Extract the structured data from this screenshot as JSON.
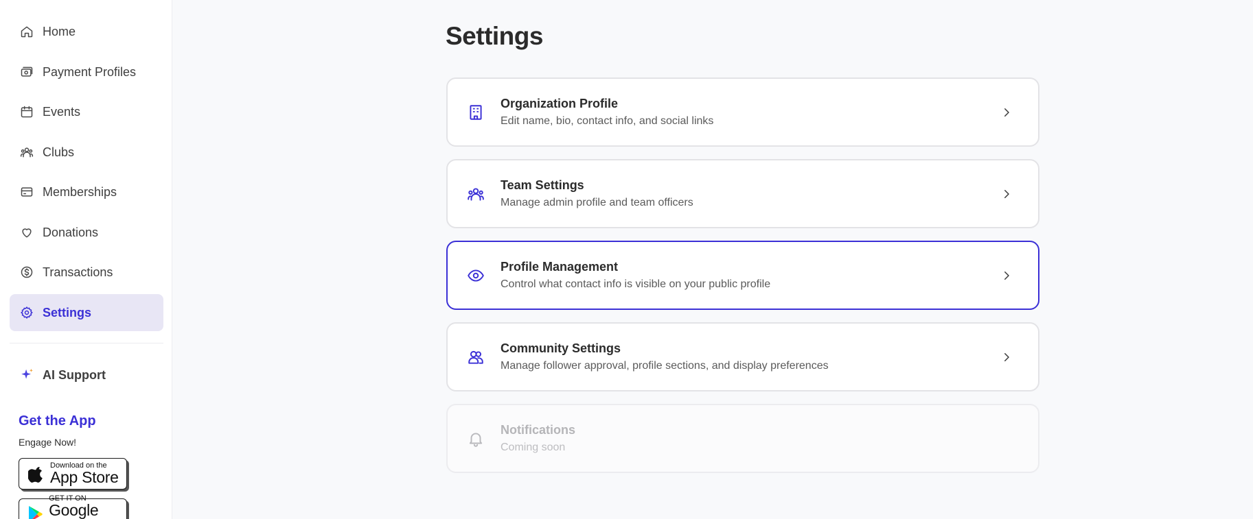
{
  "sidebar": {
    "items": [
      {
        "label": "Home",
        "icon": "home-icon"
      },
      {
        "label": "Payment Profiles",
        "icon": "wallet-icon"
      },
      {
        "label": "Events",
        "icon": "calendar-icon"
      },
      {
        "label": "Clubs",
        "icon": "users-icon"
      },
      {
        "label": "Memberships",
        "icon": "card-icon"
      },
      {
        "label": "Donations",
        "icon": "heart-icon"
      },
      {
        "label": "Transactions",
        "icon": "dollar-circle-icon"
      },
      {
        "label": "Settings",
        "icon": "gear-icon",
        "active": true
      }
    ],
    "ai_support": "AI Support",
    "get_app": {
      "title": "Get the App",
      "subtitle": "Engage Now!",
      "app_store": {
        "small": "Download on the",
        "big": "App Store"
      },
      "google_play": {
        "small": "GET IT ON",
        "big": "Google Play"
      }
    }
  },
  "main": {
    "title": "Settings",
    "cards": [
      {
        "title": "Organization Profile",
        "description": "Edit name, bio, contact info, and social links",
        "icon": "building-icon"
      },
      {
        "title": "Team Settings",
        "description": "Manage admin profile and team officers",
        "icon": "team-icon"
      },
      {
        "title": "Profile Management",
        "description": "Control what contact info is visible on your public profile",
        "icon": "eye-icon",
        "selected": true
      },
      {
        "title": "Community Settings",
        "description": "Manage follower approval, profile sections, and display preferences",
        "icon": "community-icon"
      },
      {
        "title": "Notifications",
        "description": "Coming soon",
        "icon": "bell-icon",
        "disabled": true
      }
    ]
  },
  "colors": {
    "accent": "#3b30d6",
    "active_bg": "#e8e6f5",
    "page_bg": "#f8f9fb",
    "card_border": "#e3e3e6"
  }
}
